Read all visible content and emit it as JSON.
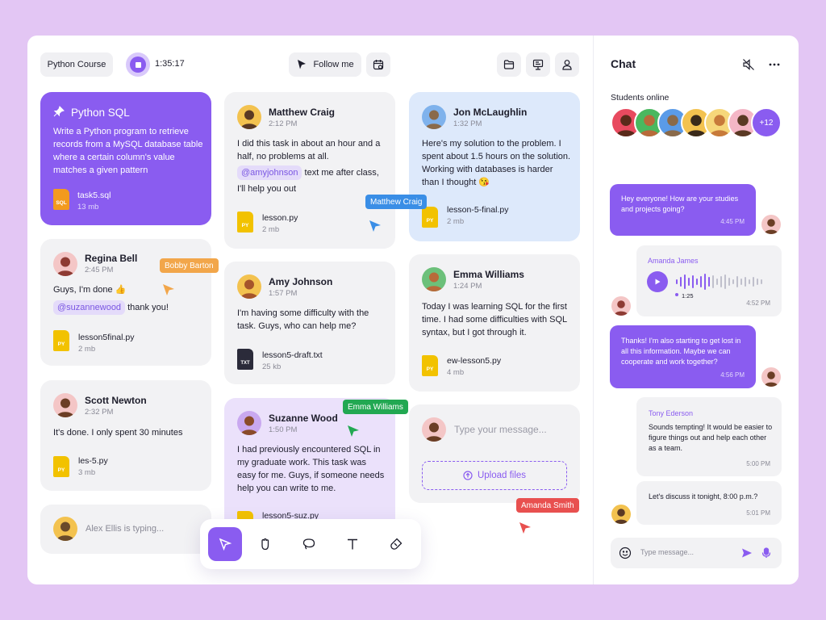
{
  "header": {
    "course_label": "Python Course",
    "timer": "1:35:17",
    "follow_label": "Follow me"
  },
  "task_card": {
    "title": "Python SQL",
    "description": "Write a Python program to retrieve records from a MySQL database table where a certain column's value matches a given pattern",
    "file": {
      "type": "SQL",
      "name": "task5.sql",
      "size": "13 mb"
    }
  },
  "posts": [
    {
      "name": "Matthew Craig",
      "time": "2:12 PM",
      "text": "I did this task in about an hour and a half, no problems at all.",
      "mention": "@amyjohnson",
      "text2": "text me after class,",
      "text3": "I'll help you out",
      "file": {
        "type": "PY",
        "name": "lesson.py",
        "size": "2 mb"
      }
    },
    {
      "name": "Jon McLaughlin",
      "time": "1:32 PM",
      "text": "Here's my solution to the problem. I spent about 1.5 hours on the solution. Working with databases is harder than I thought 😘",
      "file": {
        "type": "PY",
        "name": "lesson-5-final.py",
        "size": "2 mb"
      }
    },
    {
      "name": "Regina Bell",
      "time": "2:45 PM",
      "text": "Guys, I'm done 👍",
      "mention": "@suzannewood",
      "text2": "thank you!",
      "file": {
        "type": "PY",
        "name": "lesson5final.py",
        "size": "2 mb"
      }
    },
    {
      "name": "Amy Johnson",
      "time": "1:57 PM",
      "text": "I'm having some difficulty with the task. Guys, who can help me?",
      "file": {
        "type": "TXT",
        "name": "lesson5-draft.txt",
        "size": "25 kb"
      }
    },
    {
      "name": "Emma Williams",
      "time": "1:24 PM",
      "text": "Today I was learning SQL for the first time. I had some difficulties with SQL syntax, but I got through it.",
      "file": {
        "type": "PY",
        "name": "ew-lesson5.py",
        "size": "4 mb"
      }
    },
    {
      "name": "Scott Newton",
      "time": "2:32 PM",
      "text": "It's done. I only spent 30 minutes",
      "file": {
        "type": "PY",
        "name": "les-5.py",
        "size": "3 mb"
      }
    },
    {
      "name": "Suzanne Wood",
      "time": "1:50 PM",
      "text": "I had previously encountered SQL in my graduate work. This task was easy for me. Guys, if someone needs help you can write to me.",
      "file": {
        "type": "PY",
        "name": "lesson5-suz.py",
        "size": ""
      }
    }
  ],
  "typing_text": "Alex Ellis is typing...",
  "composer": {
    "placeholder": "Type your message...",
    "upload_label": "Upload files"
  },
  "cursor_tags": {
    "matthew": "Matthew Craig",
    "bobby": "Bobby Barton",
    "emma": "Emma Williams",
    "amanda": "Amanda Smith"
  },
  "chat": {
    "title": "Chat",
    "students_online_label": "Students online",
    "more_count": "+12",
    "messages": [
      {
        "text": "Hey everyone! How are your studies and projects going?",
        "time": "4:45 PM"
      },
      {
        "sender": "Amanda James",
        "audio_duration": "1:25",
        "time": "4:52 PM"
      },
      {
        "text": "Thanks! I'm also starting to get lost in all this information. Maybe we can cooperate and work together?",
        "time": "4:56 PM"
      },
      {
        "sender": "Tony Ederson",
        "text": "Sounds tempting! It would be easier to figure things out and help each other as a team.",
        "time": "5:00 PM"
      },
      {
        "text": "Let's discuss it tonight, 8:00 p.m.?",
        "time": "5:01 PM"
      }
    ],
    "input_placeholder": "Type message..."
  },
  "colors": {
    "accent": "#8a5cf0",
    "blue_card": "#dde9fb",
    "lavender_card": "#ebe1fb",
    "tag_blue": "#3a8ee6",
    "tag_orange": "#f2a64a",
    "tag_green": "#22a852",
    "tag_red": "#e8504f",
    "py_file": "#f2c200",
    "sql_file": "#f39a1e"
  },
  "icons": [
    "stop-icon",
    "cursor-icon",
    "calendar-icon",
    "folder-icon",
    "presentation-icon",
    "user-icon",
    "pin-icon",
    "mute-icon",
    "more-icon",
    "smile-icon",
    "send-icon",
    "mic-icon",
    "pointer-tool-icon",
    "hand-tool-icon",
    "lasso-tool-icon",
    "text-tool-icon",
    "sticker-tool-icon",
    "upload-icon",
    "play-icon"
  ]
}
